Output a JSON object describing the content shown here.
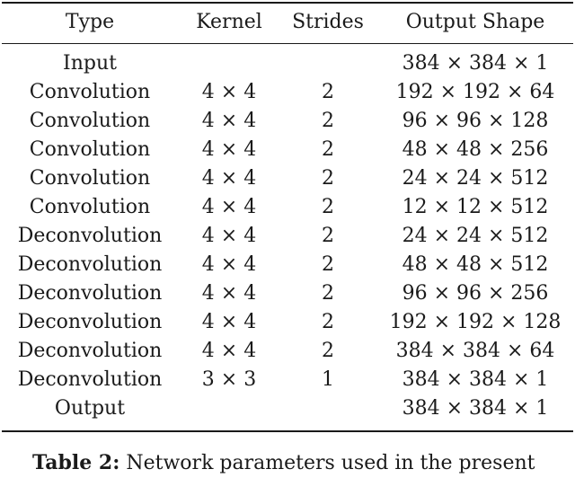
{
  "table": {
    "headers": [
      "Type",
      "Kernel",
      "Strides",
      "Output Shape"
    ],
    "rows": [
      [
        "Input",
        "",
        "",
        "384 × 384 × 1"
      ],
      [
        "Convolution",
        "4 × 4",
        "2",
        "192 × 192 × 64"
      ],
      [
        "Convolution",
        "4 × 4",
        "2",
        "96 × 96 × 128"
      ],
      [
        "Convolution",
        "4 × 4",
        "2",
        "48 × 48 × 256"
      ],
      [
        "Convolution",
        "4 × 4",
        "2",
        "24 × 24 × 512"
      ],
      [
        "Convolution",
        "4 × 4",
        "2",
        "12 × 12 × 512"
      ],
      [
        "Deconvolution",
        "4 × 4",
        "2",
        "24 × 24 × 512"
      ],
      [
        "Deconvolution",
        "4 × 4",
        "2",
        "48 × 48 × 512"
      ],
      [
        "Deconvolution",
        "4 × 4",
        "2",
        "96 × 96 × 256"
      ],
      [
        "Deconvolution",
        "4 × 4",
        "2",
        "192 × 192 × 128"
      ],
      [
        "Deconvolution",
        "4 × 4",
        "2",
        "384 × 384 × 64"
      ],
      [
        "Deconvolution",
        "3 × 3",
        "1",
        "384 × 384 × 1"
      ],
      [
        "Output",
        "",
        "",
        "384 × 384 × 1"
      ]
    ]
  },
  "caption": {
    "label": "Table 2:",
    "text": "Network parameters used in the present"
  }
}
